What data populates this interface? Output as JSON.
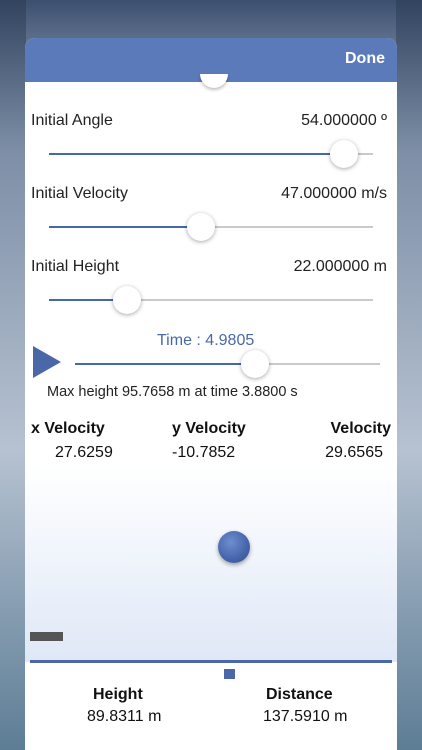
{
  "header": {
    "done_label": "Done"
  },
  "controls": {
    "angle": {
      "label": "Initial Angle",
      "value": "54.000000 º",
      "fraction": 0.91
    },
    "velocity": {
      "label": "Initial Velocity",
      "value": "47.000000 m/s",
      "fraction": 0.47
    },
    "height": {
      "label": "Initial Height",
      "value": "22.000000 m",
      "fraction": 0.24
    }
  },
  "time": {
    "label": "Time : 4.9805",
    "fraction": 0.59
  },
  "max_height_text": "Max height 95.7658 m at time 3.8800 s",
  "velocities": {
    "x": {
      "label": "x Velocity",
      "value": "27.6259"
    },
    "y": {
      "label": "y Velocity",
      "value": "-10.7852"
    },
    "total": {
      "label": "Velocity",
      "value": "29.6565"
    }
  },
  "results": {
    "height": {
      "label": "Height",
      "value": "89.8311 m"
    },
    "distance": {
      "label": "Distance",
      "value": "137.5910 m"
    }
  },
  "colors": {
    "accent": "#4a68a8",
    "header": "#5a7ab9",
    "track_off": "#c9c9c9"
  }
}
